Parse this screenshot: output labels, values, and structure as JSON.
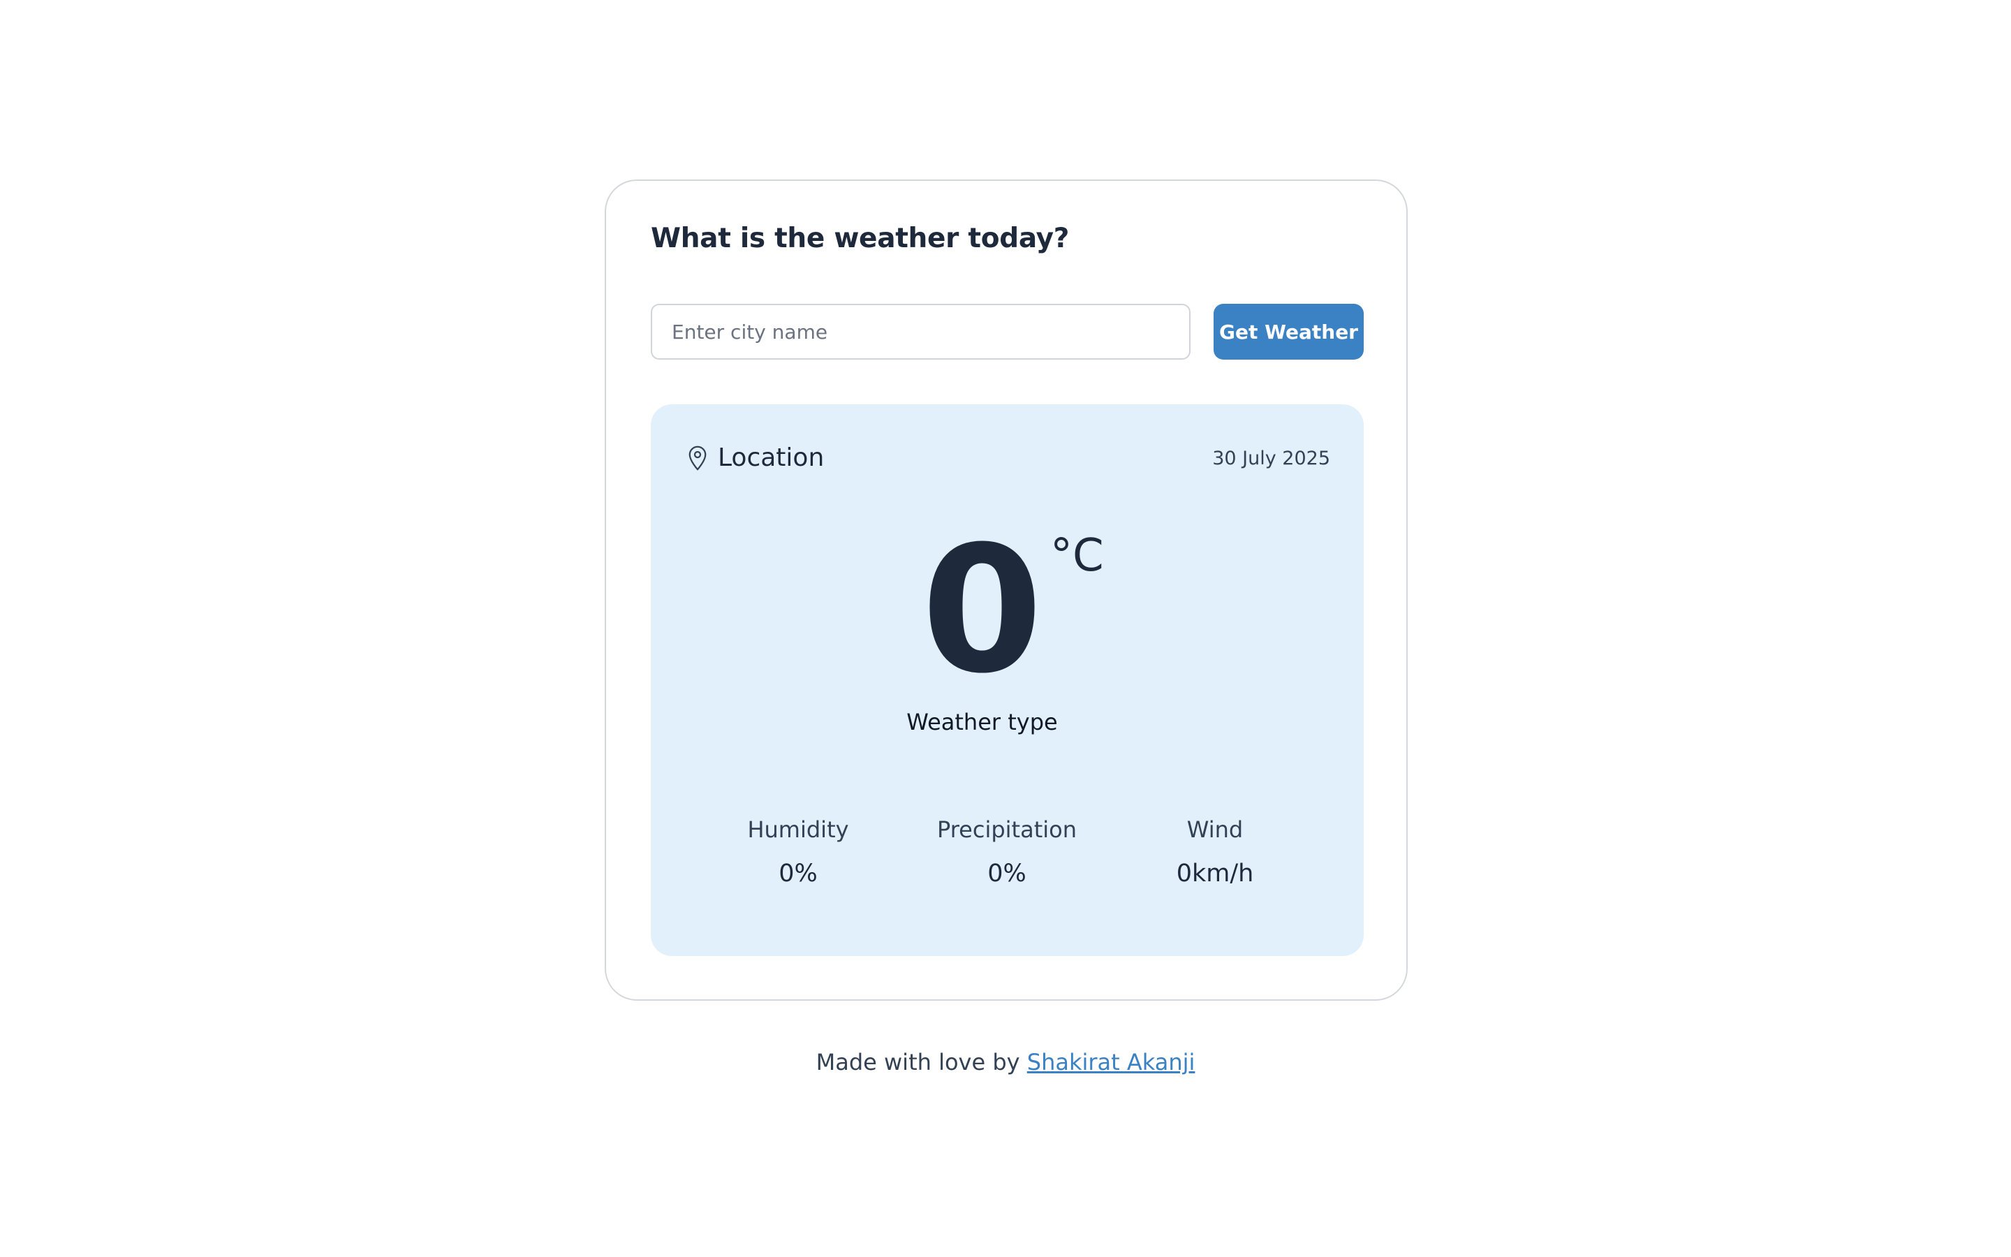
{
  "heading": "What is the weather today?",
  "search": {
    "placeholder": "Enter city name",
    "value": ""
  },
  "get_weather_label": "Get Weather",
  "weather": {
    "location": "Location",
    "date": "30 July 2025",
    "temperature": "0",
    "unit": "°C",
    "type": "Weather type",
    "stats": {
      "humidity": {
        "label": "Humidity",
        "value": "0%"
      },
      "precipitation": {
        "label": "Precipitation",
        "value": "0%"
      },
      "wind": {
        "label": "Wind",
        "value": "0km/h"
      }
    }
  },
  "footer": {
    "text": "Made with love by",
    "author": "Shakirat Akanji"
  },
  "icons": {
    "location": "map-pin-icon"
  },
  "colors": {
    "accent": "#3b82c4",
    "panel_background": "#e2f0fb",
    "text": "#1e293b",
    "card_border": "#d4d7dc"
  }
}
